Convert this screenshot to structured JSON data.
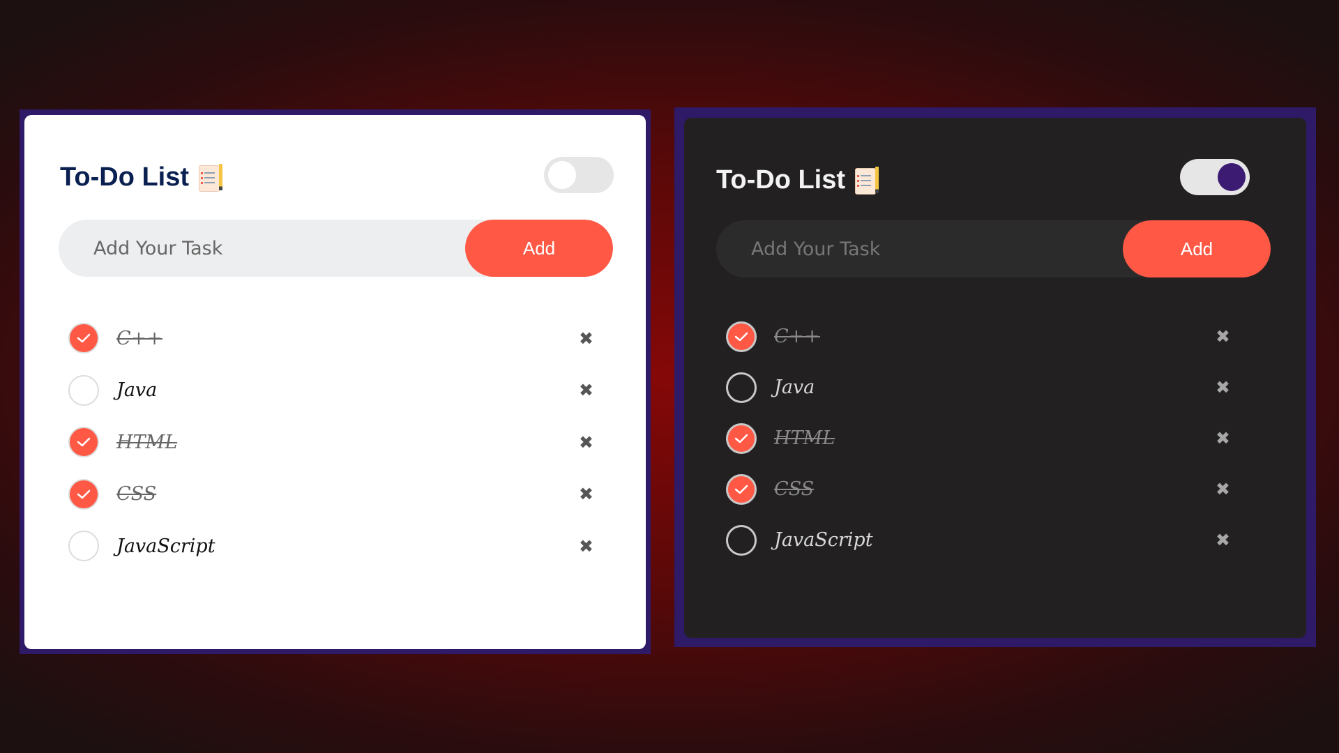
{
  "colors": {
    "accent": "#ff5945",
    "frame": "#2e1a66",
    "light_card": "#ffffff",
    "dark_card": "#222021",
    "toggle_knob_dark": "#3c1b73"
  },
  "panels": [
    {
      "theme": "light",
      "title": "To-Do List",
      "title_icon": "notepad-pencil-icon",
      "dark_mode_on": false,
      "input": {
        "value": "",
        "placeholder": "Add Your Task"
      },
      "add_label": "Add",
      "remove_icon": "✖",
      "tasks": [
        {
          "label": "C++",
          "done": true
        },
        {
          "label": "Java",
          "done": false
        },
        {
          "label": "HTML",
          "done": true
        },
        {
          "label": "CSS",
          "done": true
        },
        {
          "label": "JavaScript",
          "done": false
        }
      ]
    },
    {
      "theme": "dark",
      "title": "To-Do List",
      "title_icon": "notepad-pencil-icon",
      "dark_mode_on": true,
      "input": {
        "value": "",
        "placeholder": "Add Your Task"
      },
      "add_label": "Add",
      "remove_icon": "✖",
      "tasks": [
        {
          "label": "C++",
          "done": true
        },
        {
          "label": "Java",
          "done": false
        },
        {
          "label": "HTML",
          "done": true
        },
        {
          "label": "CSS",
          "done": true
        },
        {
          "label": "JavaScript",
          "done": false
        }
      ]
    }
  ]
}
